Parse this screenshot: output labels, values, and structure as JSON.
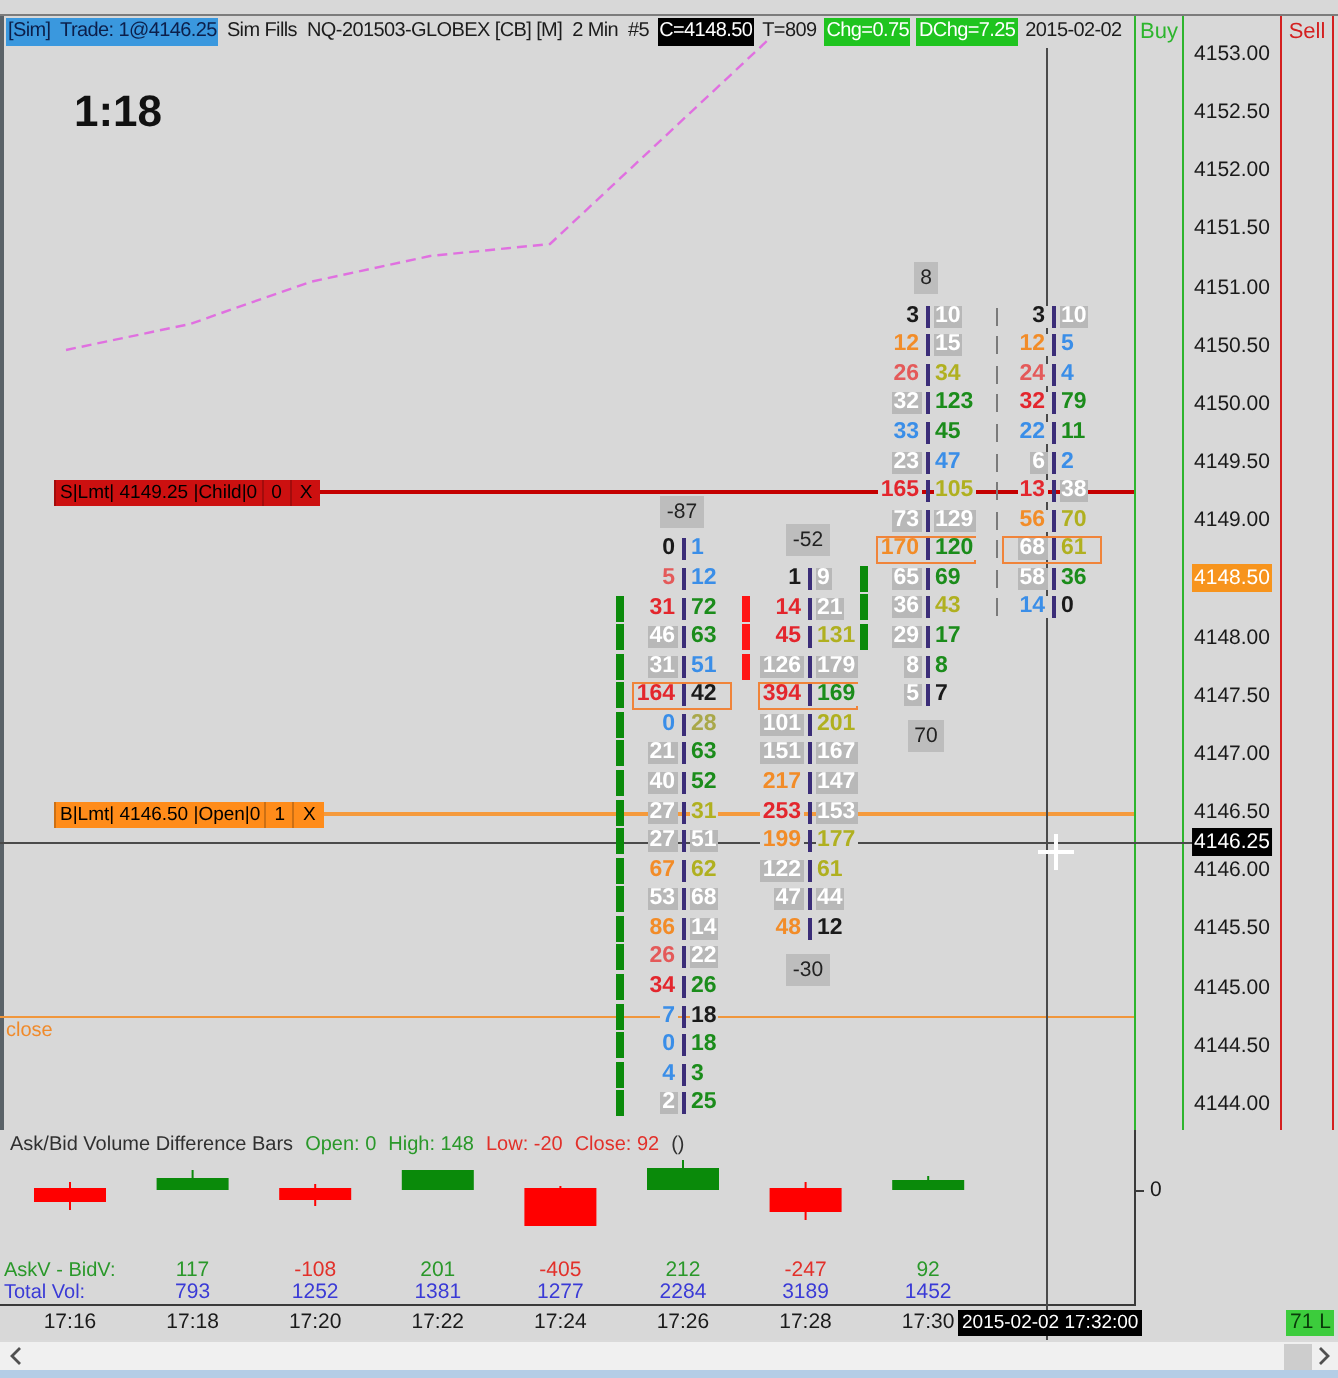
{
  "header": {
    "items": [
      {
        "kind": "account",
        "text": "[Sim]  Trade: 1@4146.25"
      },
      {
        "kind": "plain",
        "text": "Sim Fills"
      },
      {
        "kind": "plain",
        "text": "NQ-201503-GLOBEX [CB] [M]"
      },
      {
        "kind": "plain",
        "text": "2 Min"
      },
      {
        "kind": "plain",
        "text": "#5"
      },
      {
        "kind": "close",
        "text": "C=4148.50"
      },
      {
        "kind": "plain",
        "text": "T=809"
      },
      {
        "kind": "change",
        "text": "Chg=0.75"
      },
      {
        "kind": "change",
        "text": "DChg=7.25"
      },
      {
        "kind": "plain",
        "text": "2015-02-02"
      }
    ]
  },
  "bar_timer": "1:18",
  "orders": [
    {
      "kind": "sell",
      "label": "S|Lmt| 4149.25 |Child|0",
      "quantity": "0",
      "cancel": "X"
    },
    {
      "kind": "buy",
      "label": "B|Lmt| 4146.50 |Open|0",
      "quantity": "1",
      "cancel": "X"
    }
  ],
  "close_line": {
    "label": "close"
  },
  "footprint": {
    "columns": [
      {
        "top_label": "-87",
        "rows": [
          {
            "kind": "plain",
            "bid": {
              "text": "0",
              "color": "#1a1a1a"
            },
            "ask": {
              "text": "1",
              "color": "#3a8ee8"
            },
            "highlighted": false
          },
          {
            "kind": "plain",
            "bid": {
              "text": "5",
              "color": "#e45a5a"
            },
            "ask": {
              "text": "12",
              "color": "#3a8ee8"
            },
            "highlighted": false
          },
          {
            "kind": "up",
            "bid": {
              "text": "31",
              "color": "#e3262d"
            },
            "ask": {
              "text": "72",
              "color": "#1b8c1b"
            },
            "highlighted": false
          },
          {
            "kind": "up",
            "bid": {
              "text": "46",
              "color": "#ffffff"
            },
            "ask": {
              "text": "63",
              "color": "#1b8c1b"
            },
            "highlighted": false
          },
          {
            "kind": "up",
            "bid": {
              "text": "31",
              "color": "#ffffff"
            },
            "ask": {
              "text": "51",
              "color": "#3a8ee8"
            },
            "highlighted": false
          },
          {
            "kind": "up",
            "bid": {
              "text": "164",
              "color": "#e3262d"
            },
            "ask": {
              "text": "42",
              "color": "#1a1a1a"
            },
            "highlighted": true
          },
          {
            "kind": "up",
            "bid": {
              "text": "0",
              "color": "#3a8ee8"
            },
            "ask": {
              "text": "28",
              "color": "#a9a84a"
            },
            "highlighted": false
          },
          {
            "kind": "up",
            "bid": {
              "text": "21",
              "color": "#ffffff"
            },
            "ask": {
              "text": "63",
              "color": "#1b8c1b"
            },
            "highlighted": false
          },
          {
            "kind": "up",
            "bid": {
              "text": "40",
              "color": "#ffffff"
            },
            "ask": {
              "text": "52",
              "color": "#1b8c1b"
            },
            "highlighted": false
          },
          {
            "kind": "up",
            "bid": {
              "text": "27",
              "color": "#ffffff"
            },
            "ask": {
              "text": "31",
              "color": "#b0b020"
            },
            "highlighted": false
          },
          {
            "kind": "up",
            "bid": {
              "text": "27",
              "color": "#ffffff"
            },
            "ask": {
              "text": "51",
              "color": "#ffffff"
            },
            "highlighted": false
          },
          {
            "kind": "up",
            "bid": {
              "text": "67",
              "color": "#f28c28"
            },
            "ask": {
              "text": "62",
              "color": "#b0b020"
            },
            "highlighted": false
          },
          {
            "kind": "up",
            "bid": {
              "text": "53",
              "color": "#ffffff"
            },
            "ask": {
              "text": "68",
              "color": "#ffffff"
            },
            "highlighted": false
          },
          {
            "kind": "up",
            "bid": {
              "text": "86",
              "color": "#f28c28"
            },
            "ask": {
              "text": "14",
              "color": "#ffffff"
            },
            "highlighted": false
          },
          {
            "kind": "up",
            "bid": {
              "text": "26",
              "color": "#e45a5a"
            },
            "ask": {
              "text": "22",
              "color": "#ffffff"
            },
            "highlighted": false
          },
          {
            "kind": "up",
            "bid": {
              "text": "34",
              "color": "#e3262d"
            },
            "ask": {
              "text": "26",
              "color": "#1b8c1b"
            },
            "highlighted": false
          },
          {
            "kind": "up",
            "bid": {
              "text": "7",
              "color": "#3a8ee8"
            },
            "ask": {
              "text": "18",
              "color": "#1a1a1a"
            },
            "highlighted": false
          },
          {
            "kind": "up",
            "bid": {
              "text": "0",
              "color": "#3a8ee8"
            },
            "ask": {
              "text": "18",
              "color": "#1b8c1b"
            },
            "highlighted": false
          },
          {
            "kind": "up",
            "bid": {
              "text": "4",
              "color": "#3a8ee8"
            },
            "ask": {
              "text": "3",
              "color": "#1b8c1b"
            },
            "highlighted": false
          },
          {
            "kind": "up",
            "bid": {
              "text": "2",
              "color": "#ffffff"
            },
            "ask": {
              "text": "25",
              "color": "#1b8c1b"
            },
            "highlighted": false
          }
        ]
      },
      {
        "top_label": "-52",
        "bottom_label": "-30",
        "rows": [
          {
            "kind": "plain",
            "bid": {
              "text": "1",
              "color": "#1a1a1a"
            },
            "ask": {
              "text": "9",
              "color": "#ffffff"
            },
            "highlighted": false
          },
          {
            "kind": "down",
            "bid": {
              "text": "14",
              "color": "#e3262d"
            },
            "ask": {
              "text": "21",
              "color": "#ffffff"
            },
            "highlighted": false
          },
          {
            "kind": "down",
            "bid": {
              "text": "45",
              "color": "#e3262d"
            },
            "ask": {
              "text": "131",
              "color": "#b0b020"
            },
            "highlighted": false
          },
          {
            "kind": "down",
            "bid": {
              "text": "126",
              "color": "#ffffff"
            },
            "ask": {
              "text": "179",
              "color": "#ffffff"
            },
            "highlighted": false
          },
          {
            "kind": "plain",
            "bid": {
              "text": "394",
              "color": "#e3262d"
            },
            "ask": {
              "text": "169",
              "color": "#1b8c1b"
            },
            "highlighted": true
          },
          {
            "kind": "plain",
            "bid": {
              "text": "101",
              "color": "#ffffff"
            },
            "ask": {
              "text": "201",
              "color": "#b0b020"
            },
            "highlighted": false
          },
          {
            "kind": "plain",
            "bid": {
              "text": "151",
              "color": "#ffffff"
            },
            "ask": {
              "text": "167",
              "color": "#ffffff"
            },
            "highlighted": false
          },
          {
            "kind": "plain",
            "bid": {
              "text": "217",
              "color": "#f28c28"
            },
            "ask": {
              "text": "147",
              "color": "#ffffff"
            },
            "highlighted": false
          },
          {
            "kind": "plain",
            "bid": {
              "text": "253",
              "color": "#e3262d"
            },
            "ask": {
              "text": "153",
              "color": "#ffffff"
            },
            "highlighted": false
          },
          {
            "kind": "plain",
            "bid": {
              "text": "199",
              "color": "#f28c28"
            },
            "ask": {
              "text": "177",
              "color": "#b0b020"
            },
            "highlighted": false
          },
          {
            "kind": "plain",
            "bid": {
              "text": "122",
              "color": "#ffffff"
            },
            "ask": {
              "text": "61",
              "color": "#b0b020"
            },
            "highlighted": false
          },
          {
            "kind": "plain",
            "bid": {
              "text": "47",
              "color": "#ffffff"
            },
            "ask": {
              "text": "44",
              "color": "#ffffff"
            },
            "highlighted": false
          },
          {
            "kind": "plain",
            "bid": {
              "text": "48",
              "color": "#f28c28"
            },
            "ask": {
              "text": "12",
              "color": "#1a1a1a"
            },
            "highlighted": false
          }
        ]
      },
      {
        "top_label": "8",
        "bottom_label": "70",
        "rows": [
          {
            "kind": "plain",
            "bid": {
              "text": "3",
              "color": "#1a1a1a"
            },
            "ask": {
              "text": "10",
              "color": "#ffffff"
            },
            "highlighted": false
          },
          {
            "kind": "plain",
            "bid": {
              "text": "12",
              "color": "#f28c28"
            },
            "ask": {
              "text": "15",
              "color": "#ffffff"
            },
            "highlighted": false
          },
          {
            "kind": "plain",
            "bid": {
              "text": "26",
              "color": "#e45a5a"
            },
            "ask": {
              "text": "34",
              "color": "#b0b020"
            },
            "highlighted": false
          },
          {
            "kind": "plain",
            "bid": {
              "text": "32",
              "color": "#ffffff"
            },
            "ask": {
              "text": "123",
              "color": "#1b8c1b"
            },
            "highlighted": false
          },
          {
            "kind": "plain",
            "bid": {
              "text": "33",
              "color": "#3a8ee8"
            },
            "ask": {
              "text": "45",
              "color": "#1b8c1b"
            },
            "highlighted": false
          },
          {
            "kind": "plain",
            "bid": {
              "text": "23",
              "color": "#ffffff"
            },
            "ask": {
              "text": "47",
              "color": "#3a8ee8"
            },
            "highlighted": false
          },
          {
            "kind": "plain",
            "bid": {
              "text": "165",
              "color": "#e3262d"
            },
            "ask": {
              "text": "105",
              "color": "#b0b020"
            },
            "highlighted": false
          },
          {
            "kind": "plain",
            "bid": {
              "text": "73",
              "color": "#ffffff"
            },
            "ask": {
              "text": "129",
              "color": "#ffffff"
            },
            "highlighted": false
          },
          {
            "kind": "plain",
            "bid": {
              "text": "170",
              "color": "#f28c28"
            },
            "ask": {
              "text": "120",
              "color": "#1b8c1b"
            },
            "highlighted": true
          },
          {
            "kind": "up",
            "bid": {
              "text": "65",
              "color": "#ffffff"
            },
            "ask": {
              "text": "69",
              "color": "#1b8c1b"
            },
            "highlighted": false
          },
          {
            "kind": "up",
            "bid": {
              "text": "36",
              "color": "#ffffff"
            },
            "ask": {
              "text": "43",
              "color": "#b0b020"
            },
            "highlighted": false
          },
          {
            "kind": "up",
            "bid": {
              "text": "29",
              "color": "#ffffff"
            },
            "ask": {
              "text": "17",
              "color": "#1b8c1b"
            },
            "highlighted": false
          },
          {
            "kind": "plain",
            "bid": {
              "text": "8",
              "color": "#ffffff"
            },
            "ask": {
              "text": "8",
              "color": "#1b8c1b"
            },
            "highlighted": false
          },
          {
            "kind": "plain",
            "bid": {
              "text": "5",
              "color": "#ffffff"
            },
            "ask": {
              "text": "7",
              "color": "#1a1a1a"
            },
            "highlighted": false
          }
        ]
      },
      {
        "rows": [
          {
            "kind": "wick",
            "bid": {
              "text": "3",
              "color": "#1a1a1a"
            },
            "ask": {
              "text": "10",
              "color": "#ffffff"
            },
            "highlighted": false
          },
          {
            "kind": "wick",
            "bid": {
              "text": "12",
              "color": "#f28c28"
            },
            "ask": {
              "text": "5",
              "color": "#3a8ee8"
            },
            "highlighted": false
          },
          {
            "kind": "wick",
            "bid": {
              "text": "24",
              "color": "#e45a5a"
            },
            "ask": {
              "text": "4",
              "color": "#3a8ee8"
            },
            "highlighted": false
          },
          {
            "kind": "wick",
            "bid": {
              "text": "32",
              "color": "#e3262d"
            },
            "ask": {
              "text": "79",
              "color": "#1b8c1b"
            },
            "highlighted": false
          },
          {
            "kind": "wick",
            "bid": {
              "text": "22",
              "color": "#3a8ee8"
            },
            "ask": {
              "text": "11",
              "color": "#1b8c1b"
            },
            "highlighted": false
          },
          {
            "kind": "wick",
            "bid": {
              "text": "6",
              "color": "#ffffff"
            },
            "ask": {
              "text": "2",
              "color": "#3a8ee8"
            },
            "highlighted": false
          },
          {
            "kind": "wick",
            "bid": {
              "text": "13",
              "color": "#e3262d"
            },
            "ask": {
              "text": "38",
              "color": "#ffffff"
            },
            "highlighted": false
          },
          {
            "kind": "wick",
            "bid": {
              "text": "56",
              "color": "#f28c28"
            },
            "ask": {
              "text": "70",
              "color": "#b0b020"
            },
            "highlighted": false
          },
          {
            "kind": "wick",
            "bid": {
              "text": "68",
              "color": "#ffffff"
            },
            "ask": {
              "text": "61",
              "color": "#b0b020"
            },
            "highlighted": true
          },
          {
            "kind": "wick",
            "bid": {
              "text": "58",
              "color": "#ffffff"
            },
            "ask": {
              "text": "36",
              "color": "#1b8c1b"
            },
            "highlighted": false
          },
          {
            "kind": "wick",
            "bid": {
              "text": "14",
              "color": "#3a8ee8"
            },
            "ask": {
              "text": "0",
              "color": "#1a1a1a"
            },
            "highlighted": false
          }
        ]
      }
    ]
  },
  "trade_columns": [
    {
      "kind": "buy",
      "label": "Buy"
    },
    {
      "kind": "sell",
      "label": "Sell"
    }
  ],
  "price_axis": {
    "ticks": [
      {
        "kind": "tick",
        "text": "4153.00"
      },
      {
        "kind": "tick",
        "text": "4152.50"
      },
      {
        "kind": "tick",
        "text": "4152.00"
      },
      {
        "kind": "tick",
        "text": "4151.50"
      },
      {
        "kind": "tick",
        "text": "4151.00"
      },
      {
        "kind": "tick",
        "text": "4150.50"
      },
      {
        "kind": "tick",
        "text": "4150.00"
      },
      {
        "kind": "tick",
        "text": "4149.50"
      },
      {
        "kind": "tick",
        "text": "4149.00"
      },
      {
        "kind": "last",
        "text": "4148.50"
      },
      {
        "kind": "tick",
        "text": "4148.00"
      },
      {
        "kind": "tick",
        "text": "4147.50"
      },
      {
        "kind": "tick",
        "text": "4147.00"
      },
      {
        "kind": "tick",
        "text": "4146.50"
      },
      {
        "kind": "tick",
        "text": "4146.00"
      },
      {
        "kind": "tick",
        "text": "4145.50"
      },
      {
        "kind": "tick",
        "text": "4145.00"
      },
      {
        "kind": "tick",
        "text": "4144.50"
      },
      {
        "kind": "tick",
        "text": "4144.00"
      }
    ],
    "crosshair_label": "4146.25"
  },
  "indicator": {
    "title": "Ask/Bid Volume Difference Bars",
    "stats": [
      {
        "text": "Open: 0",
        "color": "#2a982a"
      },
      {
        "text": "High: 148",
        "color": "#2a982a"
      },
      {
        "text": "Low: -20",
        "color": "#e2302a"
      },
      {
        "text": "Close: 92",
        "color": "#e2302a"
      }
    ],
    "params": "()",
    "axis_label": "0",
    "rows": [
      {
        "kind": "delta",
        "label": "AskV - BidV:",
        "values": [
          {
            "text": "117",
            "color": "#2a982a"
          },
          {
            "text": "-108",
            "color": "#e2302a"
          },
          {
            "text": "201",
            "color": "#2a982a"
          },
          {
            "text": "-405",
            "color": "#e2302a"
          },
          {
            "text": "212",
            "color": "#2a982a"
          },
          {
            "text": "-247",
            "color": "#e2302a"
          },
          {
            "text": "92",
            "color": "#2a982a"
          }
        ]
      },
      {
        "kind": "volume",
        "label": "Total Vol:",
        "values": [
          {
            "text": "793"
          },
          {
            "text": "1252"
          },
          {
            "text": "1381"
          },
          {
            "text": "1277"
          },
          {
            "text": "2284"
          },
          {
            "text": "3189"
          },
          {
            "text": "1452"
          }
        ]
      }
    ]
  },
  "time_axis": {
    "labels": [
      "17:16",
      "17:18",
      "17:20",
      "17:22",
      "17:24",
      "17:26",
      "17:28",
      "17:30"
    ],
    "crosshair_label": "2015-02-02 17:32:00",
    "position_label": "71 L"
  }
}
